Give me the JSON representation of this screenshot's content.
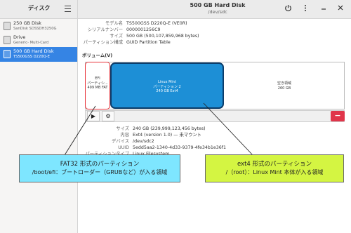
{
  "sidebar": {
    "title": "ディスク",
    "items": [
      {
        "name": "250 GB Disk",
        "sub": "SanDisk SDSSDH3250G"
      },
      {
        "name": "Drive",
        "sub": "Generic- Multi-Card"
      },
      {
        "name": "500 GB Hard Disk",
        "sub": "TS500GSS D220Q-E",
        "selected": true
      }
    ]
  },
  "header": {
    "title": "500 GB Hard Disk",
    "subtitle": "/dev/sdc",
    "icons": [
      "hamburger-menu-icon",
      "power-icon",
      "more-options-icon",
      "minimize-icon",
      "close-icon"
    ]
  },
  "disk_info": [
    {
      "key": "モデル名",
      "value": "TS500GSS D220Q-E (VE0R)"
    },
    {
      "key": "シリアルナンバー",
      "value": "0000001256C9"
    },
    {
      "key": "サイズ",
      "value": "500 GB (500,107,859,968 bytes)"
    },
    {
      "key": "パーティション構成",
      "value": "GUID Partition Table"
    }
  ],
  "volumes": {
    "label": "ボリューム(V)",
    "segments": [
      {
        "lines": [
          "EFI",
          "パーティシ...",
          "499 MB FAT"
        ]
      },
      {
        "lines": [
          "Linux Mint",
          "パーティション 2",
          "240 GB Ext4"
        ]
      },
      {
        "lines": [
          "空き領域",
          "260 GB"
        ]
      }
    ]
  },
  "toolbar": {
    "play_glyph": "▶",
    "settings_glyph": "⚙",
    "minus_glyph": "−"
  },
  "volume_info": [
    {
      "key": "サイズ",
      "value": "240 GB (239,999,123,456 bytes)"
    },
    {
      "key": "内容",
      "value": "Ext4 (version 1.0) — 未マウント"
    },
    {
      "key": "デバイス",
      "value": "/dev/sdc2"
    },
    {
      "key": "UUID",
      "value": "5edd5aa2-1340-4d33-9379-4fe34b1e36f1"
    },
    {
      "key": "パーティションタイプ",
      "value": "Linux Filesystem"
    }
  ],
  "callouts": {
    "fat32": {
      "line1": "FAT32 形式のパーティション",
      "line2": "/boot/efi：ブートローダー（GRUBなど）が入る領域"
    },
    "ext4": {
      "line1": "ext4 形式のパーティション",
      "line2": "/（root）：Linux Mint 本体が入る領域"
    }
  },
  "colors": {
    "selection": "#3584e4",
    "partition_fill": "#1d8fd6",
    "highlight_red": "#e8333a",
    "callout_blue": "#7ee6ff",
    "callout_green": "#d4f542",
    "delete_button": "#e0354a"
  }
}
